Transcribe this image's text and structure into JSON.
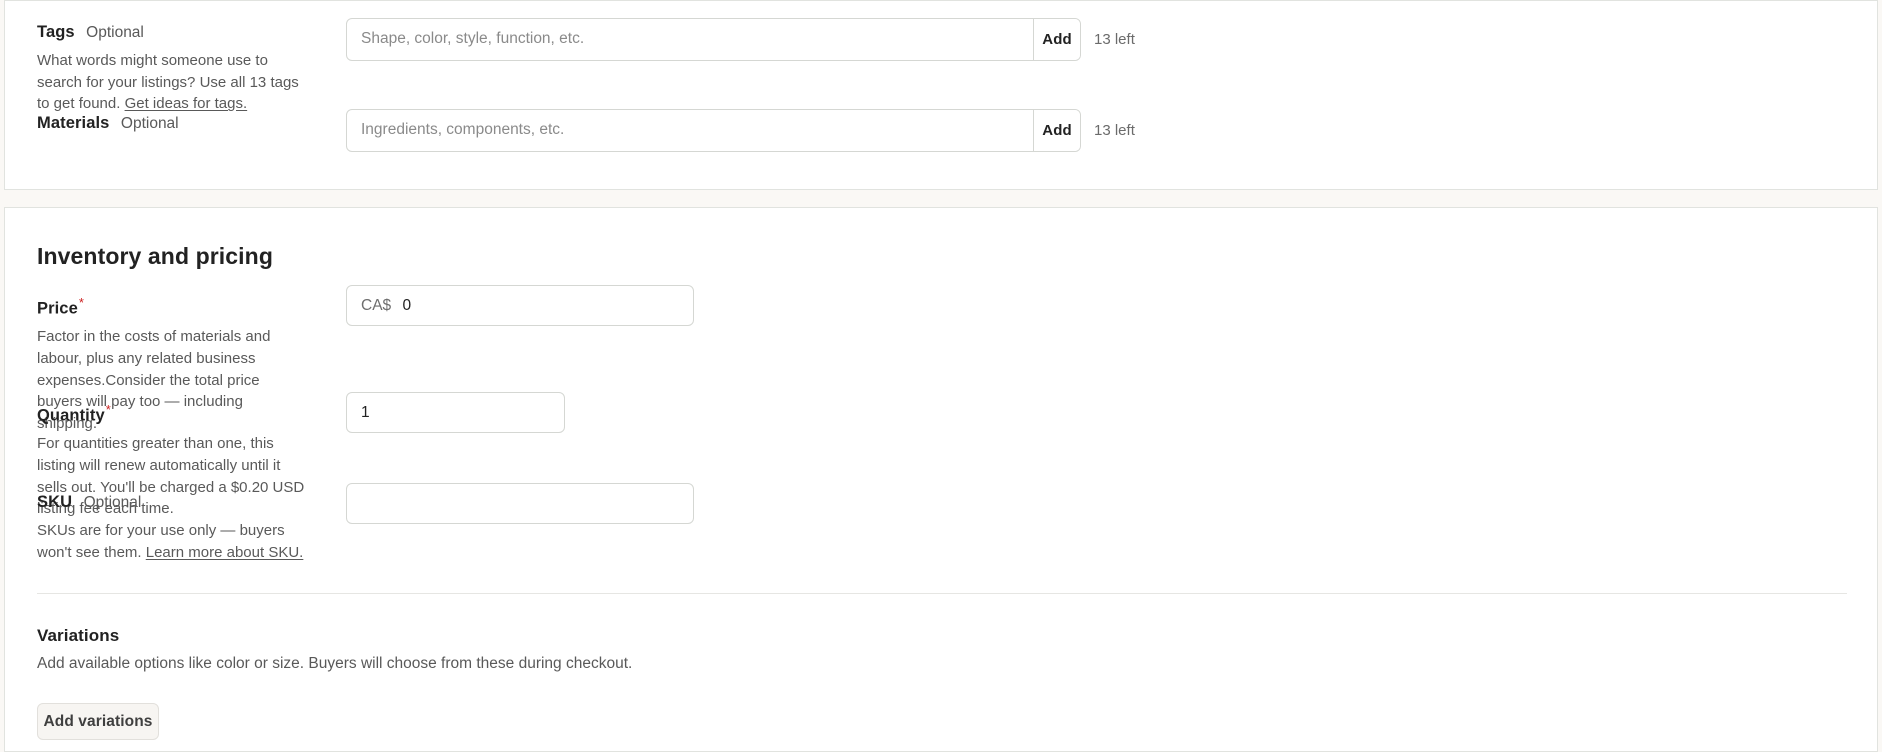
{
  "tags_section": {
    "tags": {
      "label": "Tags",
      "optional": "Optional",
      "help_before_link": "What words might someone use to search for your listings? Use all 13 tags to get found. ",
      "help_link": "Get ideas for tags.",
      "placeholder": "Shape, color, style, function, etc.",
      "value": "",
      "add_label": "Add",
      "remaining": "13 left"
    },
    "materials": {
      "label": "Materials",
      "optional": "Optional",
      "placeholder": "Ingredients, components, etc.",
      "value": "",
      "add_label": "Add",
      "remaining": "13 left"
    }
  },
  "inventory_section": {
    "title": "Inventory and pricing",
    "price": {
      "label": "Price",
      "required_marker": "*",
      "help": "Factor in the costs of materials and labour, plus any related business expenses.Consider the total price buyers will pay too — including shipping.",
      "currency_prefix": "CA$",
      "value": "0"
    },
    "quantity": {
      "label": "Quantity",
      "required_marker": "*",
      "help": "For quantities greater than one, this listing will renew automatically until it sells out. You'll be charged a $0.20 USD listing fee each time.",
      "value": "1"
    },
    "sku": {
      "label": "SKU",
      "optional": "Optional",
      "help_before_link": "SKUs are for your use only — buyers won't see them. ",
      "help_link": "Learn more about SKU.",
      "placeholder": "",
      "value": ""
    },
    "variations": {
      "title": "Variations",
      "description": "Add available options like color or size. Buyers will choose from these during checkout.",
      "add_button_label": "Add variations"
    }
  },
  "colors": {
    "page_background": "#faf8f5",
    "card_background": "#ffffff",
    "card_border": "#e1e3df",
    "text_primary": "#222222",
    "text_secondary": "#595959",
    "input_border": "#d5d7d3",
    "required_star": "#cc1f1f",
    "ghost_button_background": "#f7f5f2"
  }
}
